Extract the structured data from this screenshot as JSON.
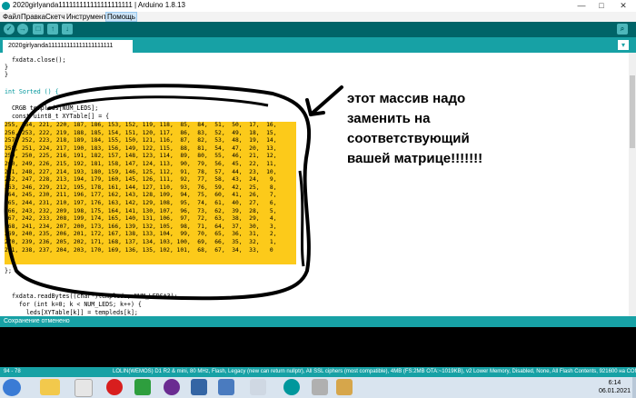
{
  "window": {
    "title": "2020girlyanda111111111111111111111 | Arduino 1.8.13",
    "controls": [
      "—",
      "□",
      "✕"
    ]
  },
  "menu": [
    "Файл",
    "Правка",
    "Скетч",
    "Инструменты",
    "Помощь"
  ],
  "tab": {
    "label": "2020girlyanda111111111111111111111",
    "menu_glyph": "▾"
  },
  "toolbar_glyphs": [
    "✓",
    "→",
    "□",
    "↑",
    "↓"
  ],
  "serial_glyph": "⌕",
  "code_top": [
    "  fxdata.close();",
    "}",
    "}",
    "",
    "int Sorted () {",
    "",
    "  CRGB templeds[NUM_LEDS];",
    "  const uint8_t XYTable[] = {"
  ],
  "code_bottom": [
    "};",
    "",
    "",
    "  fxdata.readBytes((char*)templeds, NUM_LEDS*3);",
    "    for (int k=0; k < NUM_LEDS; k++) {",
    "      leds[XYTable[k]] = templeds[k];"
  ],
  "matrix_rows": [
    "255, 254, 221, 220, 187, 186, 153, 152, 119, 118,  85,  84,  51,  50,  17,  16,",
    "256, 253, 222, 219, 188, 185, 154, 151, 120, 117,  86,  83,  52,  49,  18,  15,",
    "257, 252, 223, 218, 189, 184, 155, 150, 121, 116,  87,  82,  53,  48,  19,  14,",
    "258, 251, 224, 217, 190, 183, 156, 149, 122, 115,  88,  81,  54,  47,  20,  13,",
    "259, 250, 225, 216, 191, 182, 157, 148, 123, 114,  89,  80,  55,  46,  21,  12,",
    "260, 249, 226, 215, 192, 181, 158, 147, 124, 113,  90,  79,  56,  45,  22,  11,",
    "261, 248, 227, 214, 193, 180, 159, 146, 125, 112,  91,  78,  57,  44,  23,  10,",
    "262, 247, 228, 213, 194, 179, 160, 145, 126, 111,  92,  77,  58,  43,  24,   9,",
    "263, 246, 229, 212, 195, 178, 161, 144, 127, 110,  93,  76,  59,  42,  25,   8,",
    "264, 245, 230, 211, 196, 177, 162, 143, 128, 109,  94,  75,  60,  41,  26,   7,",
    "265, 244, 231, 210, 197, 176, 163, 142, 129, 108,  95,  74,  61,  40,  27,   6,",
    "266, 243, 232, 209, 198, 175, 164, 141, 130, 107,  96,  73,  62,  39,  28,   5,",
    "267, 242, 233, 208, 199, 174, 165, 140, 131, 106,  97,  72,  63,  38,  29,   4,",
    "268, 241, 234, 207, 200, 173, 166, 139, 132, 105,  98,  71,  64,  37,  30,   3,",
    "269, 240, 235, 206, 201, 172, 167, 138, 133, 104,  99,  70,  65,  36,  31,   2,",
    "270, 239, 236, 205, 202, 171, 168, 137, 134, 103, 100,  69,  66,  35,  32,   1,",
    "271, 238, 237, 204, 203, 170, 169, 136, 135, 102, 101,  68,  67,  34,  33,   0"
  ],
  "annotation_lines": [
    "этот массив надо",
    "заменить на",
    "соответствующий",
    "вашей матрице!!!!!!!"
  ],
  "status_message": "Сохранение отменено",
  "cursor_position": "94 - 78",
  "board_info": "LOLIN(WEMOS) D1 R2 & mini, 80 MHz, Flash, Legacy (new can return nullptr), All SSL ciphers (most compatible), 4MB (FS:2MB OTA:~1019KB), v2 Lower Memory, Disabled, None, All Flash Contents, 921600 на COM2",
  "clock": {
    "time": "6:14",
    "date": "06.01.2021"
  },
  "colors": {
    "teal_dark": "#006468",
    "teal": "#17a1a5",
    "highlight": "#fcca1a"
  }
}
